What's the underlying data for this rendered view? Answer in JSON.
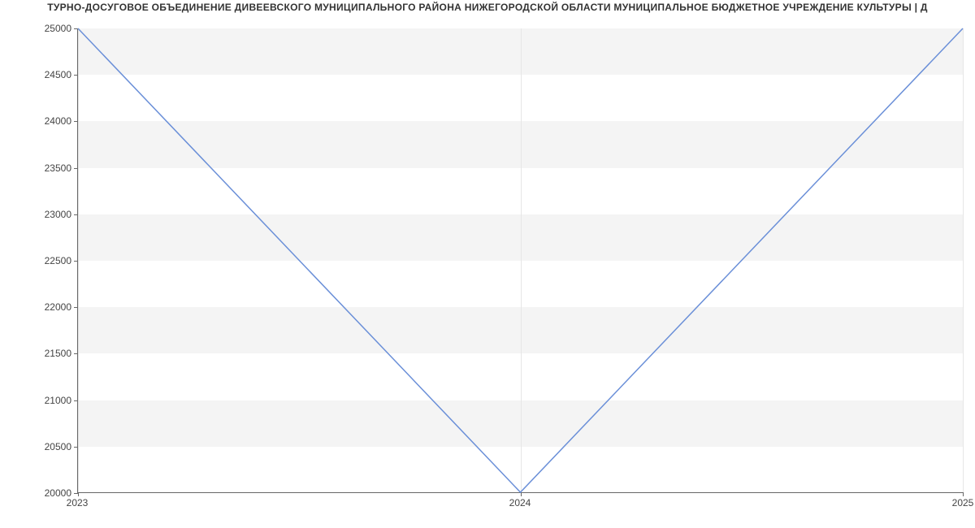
{
  "chart_data": {
    "type": "line",
    "title": "ТУРНО-ДОСУГОВОЕ ОБЪЕДИНЕНИЕ ДИВЕЕВСКОГО МУНИЦИПАЛЬНОГО РАЙОНА НИЖЕГОРОДСКОЙ ОБЛАСТИ МУНИЦИПАЛЬНОЕ БЮДЖЕТНОЕ УЧРЕЖДЕНИЕ КУЛЬТУРЫ | Д",
    "x": [
      2023,
      2024,
      2025
    ],
    "values": [
      25000,
      20000,
      25000
    ],
    "xlabel": "",
    "ylabel": "",
    "ylim": [
      20000,
      25000
    ],
    "xlim": [
      2023,
      2025
    ],
    "y_ticks": [
      20000,
      20500,
      21000,
      21500,
      22000,
      22500,
      23000,
      23500,
      24000,
      24500,
      25000
    ],
    "x_ticks": [
      2023,
      2024,
      2025
    ],
    "line_color": "#6a8fd8",
    "band_color": "#f4f4f4"
  },
  "labels": {
    "y": {
      "t20000": "20000",
      "t20500": "20500",
      "t21000": "21000",
      "t21500": "21500",
      "t22000": "22000",
      "t22500": "22500",
      "t23000": "23000",
      "t23500": "23500",
      "t24000": "24000",
      "t24500": "24500",
      "t25000": "25000"
    },
    "x": {
      "t2023": "2023",
      "t2024": "2024",
      "t2025": "2025"
    }
  }
}
